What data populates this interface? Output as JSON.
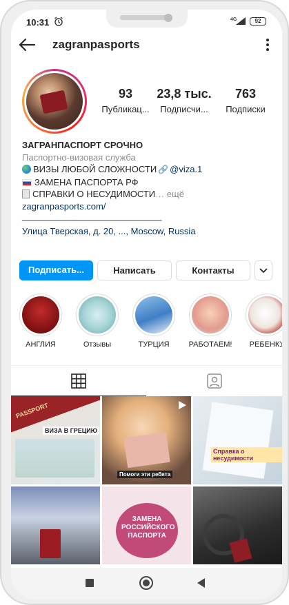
{
  "status_bar": {
    "time": "10:31",
    "network": "4G",
    "battery": "92"
  },
  "header": {
    "username": "zagranpasports"
  },
  "stats": [
    {
      "value": "93",
      "label": "Публикац..."
    },
    {
      "value": "23,8 тыс.",
      "label": "Подписчи..."
    },
    {
      "value": "763",
      "label": "Подписки"
    }
  ],
  "bio": {
    "name": "ЗАГРАНПАСПОРТ СРОЧНО",
    "category": "Паспортно-визовая служба",
    "line1_text": "ВИЗЫ ЛЮБОЙ СЛОЖНОСТИ",
    "line1_mention": "@viza.1",
    "line2_text": "ЗАМЕНА ПАСПОРТА РФ",
    "line3_text": "СПРАВКИ О НЕСУДИМОСТИ",
    "line3_more": "… ещё",
    "website": "zagranpasports.com/",
    "divider": "____________________________",
    "address": "Улица Тверская, д. 20, ..., Moscow, Russia"
  },
  "buttons": {
    "follow": "Подписать...",
    "message": "Написать",
    "contacts": "Контакты"
  },
  "highlights": [
    {
      "label": "АНГЛИЯ"
    },
    {
      "label": "Отзывы"
    },
    {
      "label": "ТУРЦИЯ"
    },
    {
      "label": "РАБОТАЕМ!"
    },
    {
      "label": "РЕБЕНКУ"
    }
  ],
  "grid_captions": {
    "cell1": "ВИЗА В ГРЕЦИЮ",
    "cell1_top": "PASSPORT",
    "cell2": "Помоги эти ребята",
    "cell3": "Справка о несудимости",
    "cell5": "ЗАМЕНА РОССИЙСКОГО ПАСПОРТА"
  },
  "colors": {
    "primary_button": "#0095f6",
    "link": "#00376b",
    "secondary_text": "#8e8e8e"
  }
}
